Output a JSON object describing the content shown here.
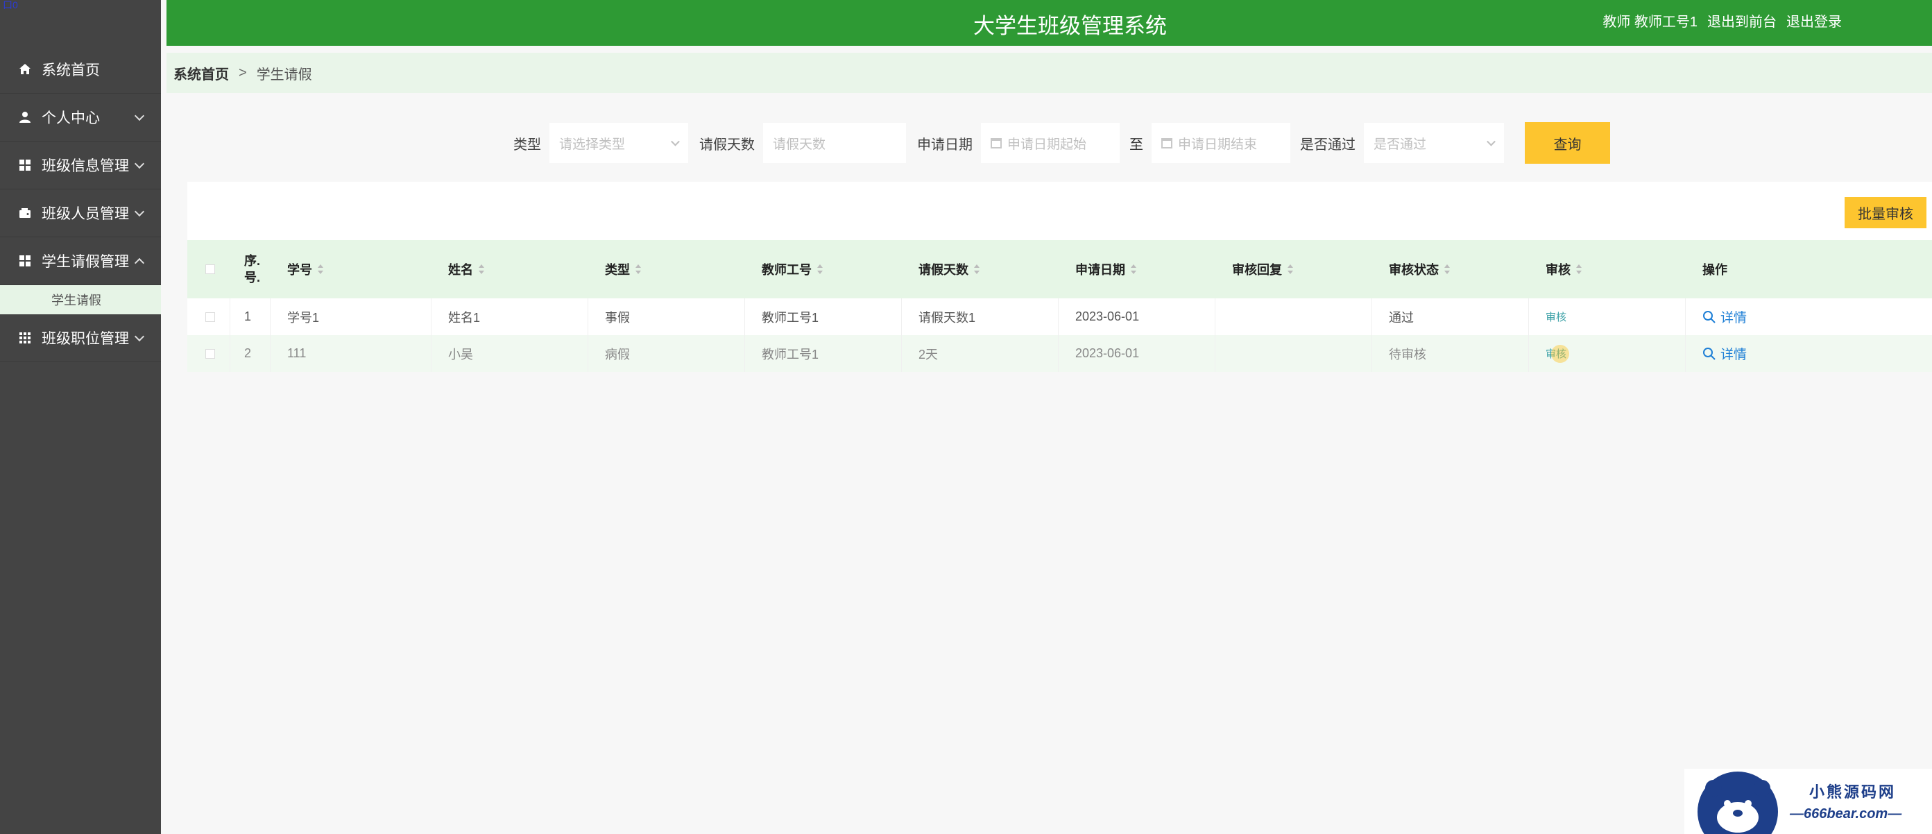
{
  "app": {
    "title": "大学生班级管理系统"
  },
  "header": {
    "user_role": "教师",
    "user_name": "教师工号1",
    "to_front": "退出到前台",
    "logout": "退出登录"
  },
  "sidebar": {
    "logo_text": "口0",
    "items": [
      {
        "label": "系统首页",
        "icon": "home-icon"
      },
      {
        "label": "个人中心",
        "icon": "user-icon"
      },
      {
        "label": "班级信息管理",
        "icon": "grid-icon"
      },
      {
        "label": "班级人员管理",
        "icon": "wallet-icon"
      },
      {
        "label": "学生请假管理",
        "icon": "grid-icon"
      },
      {
        "label": "班级职位管理",
        "icon": "apps-icon"
      }
    ],
    "active_sub": "学生请假"
  },
  "breadcrumb": {
    "home": "系统首页",
    "sep": ">",
    "current": "学生请假"
  },
  "filters": {
    "type_label": "类型",
    "type_placeholder": "请选择类型",
    "days_label": "请假天数",
    "days_placeholder": "请假天数",
    "date_label": "申请日期",
    "date_start": "申请日期起始",
    "to": "至",
    "date_end": "申请日期结束",
    "pass_label": "是否通过",
    "pass_placeholder": "是否通过",
    "query": "查询"
  },
  "batch_audit": "批量审核",
  "table": {
    "headers": [
      "序.号.",
      "学号",
      "姓名",
      "类型",
      "教师工号",
      "请假天数",
      "申请日期",
      "审核回复",
      "审核状态",
      "审核",
      "操作"
    ],
    "rows": [
      {
        "idx": "1",
        "student_no": "学号1",
        "name": "姓名1",
        "type": "事假",
        "teacher_no": "教师工号1",
        "days": "请假天数1",
        "date": "2023-06-01",
        "reply": "",
        "status": "通过",
        "audit": "审核",
        "op": "详情"
      },
      {
        "idx": "2",
        "student_no": "111",
        "name": "小吴",
        "type": "病假",
        "teacher_no": "教师工号1",
        "days": "2天",
        "date": "2023-06-01",
        "reply": "",
        "status": "待审核",
        "audit": "审核",
        "op": "详情"
      }
    ]
  },
  "watermark": {
    "line1": "小熊源码网",
    "line2": "—666bear.com—"
  },
  "colors": {
    "header_green": "#2e9a34",
    "sidebar_bg": "#444444",
    "accent_yellow": "#fdc52f",
    "link_teal": "#3aa0a6"
  }
}
